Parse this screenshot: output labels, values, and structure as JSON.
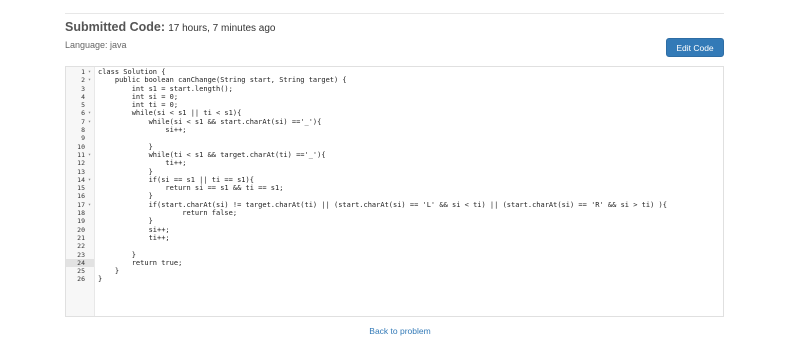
{
  "header": {
    "submitted_label": "Submitted Code:",
    "submitted_time": "17 hours, 7 minutes ago",
    "language": "Language: java",
    "edit_button": "Edit Code"
  },
  "code": {
    "active_line": 24,
    "lines": [
      {
        "n": "1",
        "fold": true,
        "text": "class Solution {"
      },
      {
        "n": "2",
        "fold": true,
        "text": "    public boolean canChange(String start, String target) {"
      },
      {
        "n": "3",
        "fold": false,
        "text": "        int s1 = start.length();"
      },
      {
        "n": "4",
        "fold": false,
        "text": "        int si = 0;"
      },
      {
        "n": "5",
        "fold": false,
        "text": "        int ti = 0;"
      },
      {
        "n": "6",
        "fold": true,
        "text": "        while(si < s1 || ti < s1){"
      },
      {
        "n": "7",
        "fold": true,
        "text": "            while(si < s1 && start.charAt(si) =='_'){"
      },
      {
        "n": "8",
        "fold": false,
        "text": "                si++;"
      },
      {
        "n": "9",
        "fold": false,
        "text": ""
      },
      {
        "n": "10",
        "fold": false,
        "text": "            }"
      },
      {
        "n": "11",
        "fold": true,
        "text": "            while(ti < s1 && target.charAt(ti) =='_'){"
      },
      {
        "n": "12",
        "fold": false,
        "text": "                ti++;"
      },
      {
        "n": "13",
        "fold": false,
        "text": "            }"
      },
      {
        "n": "14",
        "fold": true,
        "text": "            if(si == s1 || ti == s1){"
      },
      {
        "n": "15",
        "fold": false,
        "text": "                return si == s1 && ti == s1;"
      },
      {
        "n": "16",
        "fold": false,
        "text": "            }"
      },
      {
        "n": "17",
        "fold": true,
        "text": "            if(start.charAt(si) != target.charAt(ti) || (start.charAt(si) == 'L' && si < ti) || (start.charAt(si) == 'R' && si > ti) ){"
      },
      {
        "n": "18",
        "fold": false,
        "text": "                    return false;"
      },
      {
        "n": "19",
        "fold": false,
        "text": "            }"
      },
      {
        "n": "20",
        "fold": false,
        "text": "            si++;"
      },
      {
        "n": "21",
        "fold": false,
        "text": "            ti++;"
      },
      {
        "n": "22",
        "fold": false,
        "text": ""
      },
      {
        "n": "23",
        "fold": false,
        "text": "        }"
      },
      {
        "n": "24",
        "fold": false,
        "text": "        return true;"
      },
      {
        "n": "25",
        "fold": false,
        "text": "    }"
      },
      {
        "n": "26",
        "fold": false,
        "text": "}"
      }
    ]
  },
  "footer": {
    "back_link": "Back to problem"
  }
}
